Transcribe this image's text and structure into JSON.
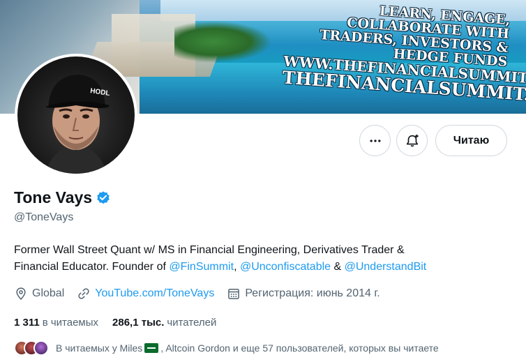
{
  "banner": {
    "line1": "LEARN, ENGAGE, COLLABORATE WITH",
    "line2": "TRADERS, INVESTORS & HEDGE FUNDS",
    "line3": "WWW.THEFINANCIALSUMMIT.COM",
    "line4": "THEFINANCIALSUMMIT.COM"
  },
  "avatar": {
    "cap_text": "HODL"
  },
  "actions": {
    "more_icon": "more-horizontal-icon",
    "notify_icon": "bell-plus-icon",
    "follow_label": "Читаю"
  },
  "profile": {
    "name": "Tone Vays",
    "handle": "@ToneVays",
    "verified_color": "#1d9bf0"
  },
  "bio": {
    "text1": "Former Wall Street Quant w/ MS in Financial Engineering, Derivatives Trader &",
    "text2": "Financial Educator. Founder of ",
    "mention1": "@FinSummit",
    "sep1": ", ",
    "mention2": "@Unconfiscatable",
    "sep2": " & ",
    "mention3": "@UnderstandBit"
  },
  "meta": {
    "location": "Global",
    "website": "YouTube.com/ToneVays",
    "joined": "Регистрация: июнь 2014 г."
  },
  "stats": {
    "following_count": "1 311",
    "following_label": "в читаемых",
    "followers_count": "286,1 тыс.",
    "followers_label": "читателей"
  },
  "followed_by": {
    "prefix": "В читаемых у Miles",
    "suffix": ", Altcoin Gordon и еще 57 пользователей, которых вы читаете"
  },
  "colors": {
    "accent": "#1d9bf0",
    "muted": "#536471",
    "border": "#cfd9de"
  }
}
